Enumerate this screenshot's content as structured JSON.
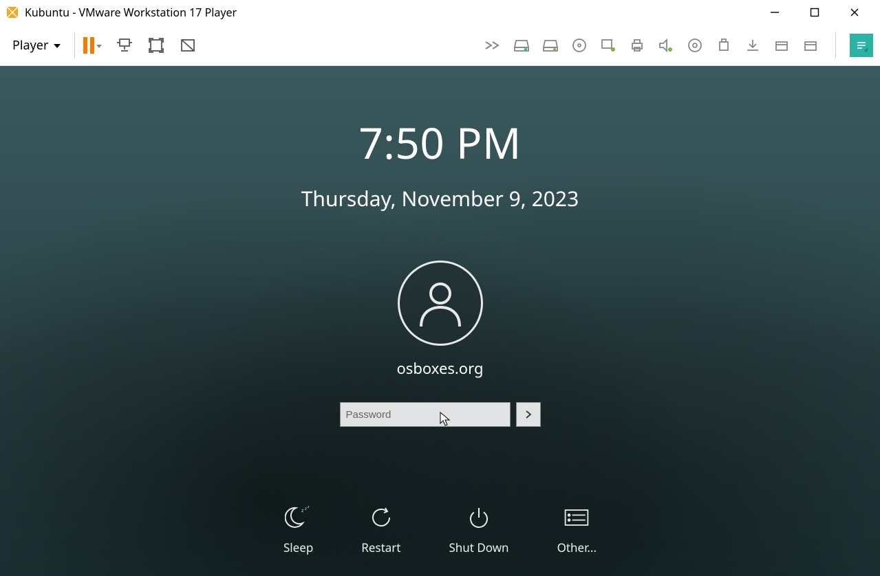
{
  "window": {
    "title": "Kubuntu - VMware Workstation 17 Player"
  },
  "toolbar": {
    "player_label": "Player"
  },
  "lockscreen": {
    "time": "7:50 PM",
    "date": "Thursday, November 9, 2023",
    "username": "osboxes.org",
    "password_placeholder": "Password",
    "actions": {
      "sleep": "Sleep",
      "restart": "Restart",
      "shutdown": "Shut Down",
      "other": "Other..."
    }
  }
}
